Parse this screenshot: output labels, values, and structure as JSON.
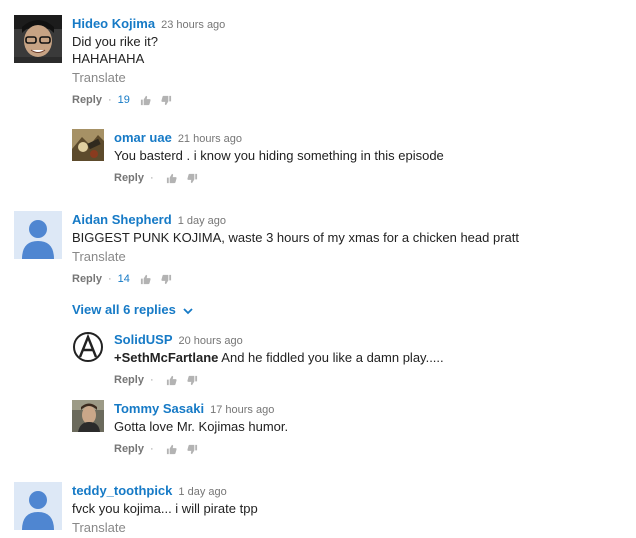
{
  "comments": [
    {
      "author": "Hideo Kojima",
      "time": "23 hours ago",
      "lines": [
        "Did you rike it?",
        "HAHAHAHA"
      ],
      "translate": "Translate",
      "reply_label": "Reply",
      "likes": "19"
    },
    {
      "author": "omar uae",
      "time": "21 hours ago",
      "lines": [
        "You basterd . i know you hiding something in this episode"
      ],
      "reply_label": "Reply"
    },
    {
      "author": "Aidan Shepherd",
      "time": "1 day ago",
      "lines": [
        "BIGGEST PUNK KOJIMA, waste 3 hours of my xmas for a chicken head pratt"
      ],
      "translate": "Translate",
      "reply_label": "Reply",
      "likes": "14"
    },
    {
      "author": "SolidUSP",
      "time": "20 hours ago",
      "mention": "+SethMcFartlane",
      "text": " And he fiddled you like a damn play.....",
      "reply_label": "Reply"
    },
    {
      "author": "Tommy Sasaki",
      "time": "17 hours ago",
      "lines": [
        "Gotta love Mr. Kojimas humor."
      ],
      "reply_label": "Reply"
    },
    {
      "author": "teddy_toothpick",
      "time": "1 day ago",
      "lines": [
        "fvck you kojima... i will pirate tpp"
      ],
      "translate": "Translate"
    }
  ],
  "view_all_replies": "View all 6 replies",
  "separator": "·",
  "icons": {
    "like": "thumbs-up-icon",
    "dislike": "thumbs-down-icon",
    "expand": "chevron-down-icon",
    "default_avatar": "default-user-avatar"
  },
  "colors": {
    "link_blue": "#167ac6",
    "meta_gray": "#767676",
    "default_avatar_bg": "#dde8f6",
    "default_avatar_fg": "#4f86d1"
  }
}
